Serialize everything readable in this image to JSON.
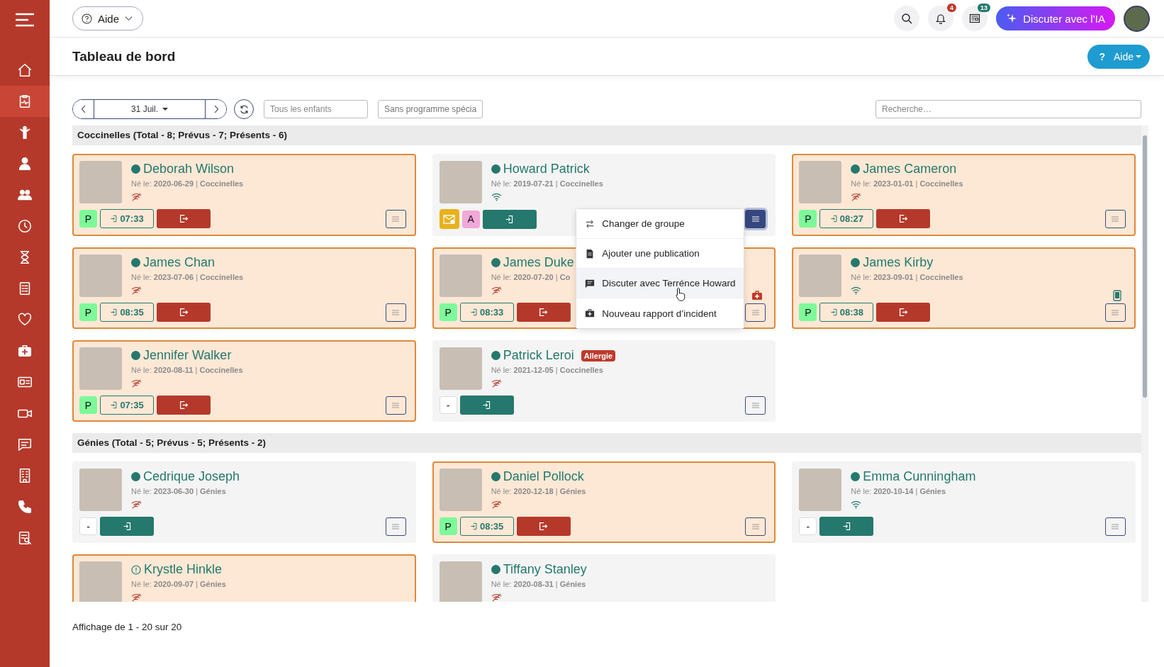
{
  "sidebar": {
    "items": [
      {
        "kind": "home",
        "selected": false
      },
      {
        "kind": "dashboard",
        "selected": true
      },
      {
        "kind": "child",
        "selected": false
      },
      {
        "kind": "person",
        "selected": false
      },
      {
        "kind": "group",
        "selected": false
      },
      {
        "kind": "clock",
        "selected": false
      },
      {
        "kind": "hourglass",
        "selected": false
      },
      {
        "kind": "list",
        "selected": false
      },
      {
        "kind": "heart",
        "selected": false
      },
      {
        "kind": "medical",
        "selected": false
      },
      {
        "kind": "card",
        "selected": false
      },
      {
        "kind": "video",
        "selected": false
      },
      {
        "kind": "chat",
        "selected": false
      },
      {
        "kind": "building",
        "selected": false
      },
      {
        "kind": "phone",
        "selected": false
      },
      {
        "kind": "report",
        "selected": false
      }
    ]
  },
  "topbar": {
    "help_label": "Aide",
    "notifications_count": "4",
    "news_count": "13",
    "ai_button": "Discuter avec l’IA"
  },
  "page": {
    "title": "Tableau de bord",
    "help_icon": "?",
    "help_label": "Aide"
  },
  "toolbar": {
    "date": "31 Juil.",
    "children_filter": {
      "placeholder": "Tous les enfants"
    },
    "program_filter": "Sans programme spécia",
    "search": {
      "placeholder": "Recherche…"
    }
  },
  "groups": [
    {
      "title": "Coccinelles (Total - 8; Prévus - 7; Présents - 6)",
      "children": [
        {
          "name": "Deborah Wilson",
          "alert": false,
          "info": "Né le: **2020-06-29** | **Coccinelles**",
          "online": false,
          "present": true,
          "badges": [
            {
              "kind": "present",
              "text": "P"
            }
          ],
          "time": "07:33",
          "menu_active": false
        },
        {
          "name": "Howard Patrick",
          "alert": false,
          "info": "Né le: **2019-07-21** | **Coccinelles**",
          "online": true,
          "present": false,
          "badges": [
            {
              "kind": "mail"
            },
            {
              "kind": "absent",
              "text": "A"
            }
          ],
          "menu_active": true,
          "menu_open": true
        },
        {
          "name": "James Cameron",
          "alert": false,
          "info": "Né le: **2023-01-01** | **Coccinelles**",
          "online": false,
          "present": true,
          "badges": [
            {
              "kind": "present",
              "text": "P"
            }
          ],
          "time": "08:27",
          "menu_active": false
        },
        {
          "name": "James Chan",
          "alert": false,
          "info": "Né le: **2023-07-06** | **Coccinelles**",
          "online": false,
          "present": true,
          "badges": [
            {
              "kind": "present",
              "text": "P"
            }
          ],
          "time": "08:35",
          "menu_active": false
        },
        {
          "name": "James Duke",
          "alert": false,
          "info": "Né le: **2020-07-20** | **Co**",
          "online": false,
          "present": true,
          "badges": [
            {
              "kind": "present",
              "text": "P"
            }
          ],
          "time": "08:33",
          "side_icon": {
            "kind": "medical"
          },
          "menu_active": false
        },
        {
          "name": "James Kirby",
          "alert": false,
          "info": "Né le: **2023-09-01** | **Coccinelles**",
          "online": true,
          "present": true,
          "badges": [
            {
              "kind": "present",
              "text": "P"
            }
          ],
          "time": "08:38",
          "side_icon": {
            "kind": "tablet"
          },
          "menu_active": false
        },
        {
          "name": "Jennifer Walker",
          "alert": false,
          "info": "Né le: **2020-08-11** | **Coccinelles**",
          "online": false,
          "present": true,
          "badges": [
            {
              "kind": "present",
              "text": "P"
            }
          ],
          "time": "07:35",
          "menu_active": false
        },
        {
          "name": "Patrick Leroi",
          "alert": false,
          "allergy": "Allergie",
          "info": "Né le: **2021-12-05** | **Coccinelles**",
          "online": false,
          "present": false,
          "badges": [
            {
              "kind": "none",
              "text": "-"
            }
          ],
          "menu_active": false
        }
      ]
    },
    {
      "title": "Génies (Total - 5; Prévus - 5; Présents - 2)",
      "children": [
        {
          "name": "Cedrique Joseph",
          "alert": false,
          "info": "Né le: **2023-06-30** | **Génies**",
          "online": false,
          "present": false,
          "badges": [
            {
              "kind": "none",
              "text": "-"
            }
          ],
          "menu_active": false
        },
        {
          "name": "Daniel Pollock",
          "alert": false,
          "info": "Né le: **2020-12-18** | **Génies**",
          "online": false,
          "present": true,
          "badges": [
            {
              "kind": "present",
              "text": "P"
            }
          ],
          "time": "08:35",
          "menu_active": false
        },
        {
          "name": "Emma Cunningham",
          "alert": false,
          "info": "Né le: **2020-10-14** | **Génies**",
          "online": true,
          "present": false,
          "badges": [
            {
              "kind": "none",
              "text": "-"
            }
          ],
          "menu_active": false
        },
        {
          "name": "Krystle Hinkle",
          "alert": true,
          "info": "Né le: **2020-09-07** | **Génies**",
          "online": false,
          "present": true
        },
        {
          "name": "Tiffany Stanley",
          "alert": false,
          "info": "Né le: **2020-08-31** | **Génies**",
          "online": false,
          "present": false
        }
      ]
    }
  ],
  "context_menu": {
    "items": [
      {
        "kind": "swap",
        "label": "Changer de groupe",
        "selected": false
      },
      {
        "kind": "document",
        "label": "Ajouter une publication",
        "selected": false
      },
      {
        "kind": "chat",
        "label": "Discuter avec Terrénce Howard",
        "selected": true
      },
      {
        "kind": "medical",
        "label": "Nouveau rapport d’incident",
        "selected": false
      }
    ]
  },
  "footer": "Affichage de 1 - 20 sur 20"
}
